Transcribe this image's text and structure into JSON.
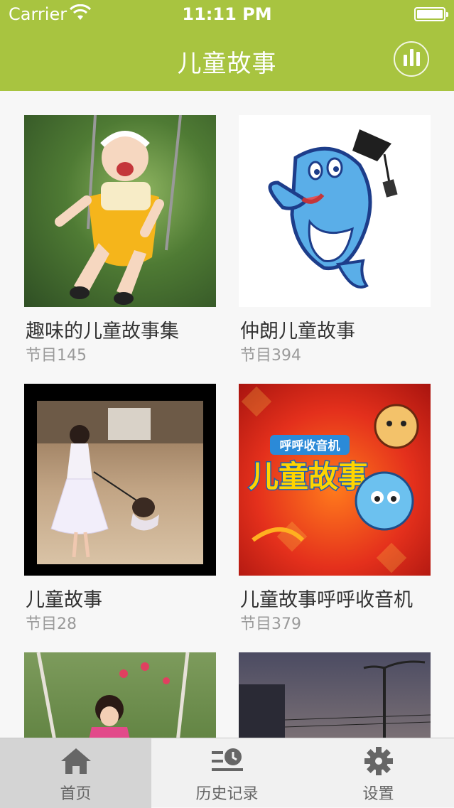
{
  "status_bar": {
    "carrier": "Carrier",
    "time": "11:11 PM"
  },
  "nav": {
    "title": "儿童故事",
    "player_icon": "equalizer-icon"
  },
  "cards": [
    {
      "title": "趣味的儿童故事集",
      "count": "节目145"
    },
    {
      "title": "仲朗儿童故事",
      "count": "节目394"
    },
    {
      "title": "儿童故事",
      "count": "节目28"
    },
    {
      "title": "儿童故事呼呼收音机",
      "count": "节目379"
    },
    {
      "title": "",
      "count": ""
    },
    {
      "title": "",
      "count": ""
    }
  ],
  "thumb_text": {
    "banner_small": "呼呼收音机",
    "banner_big": "儿童故事"
  },
  "tabs": [
    {
      "label": "首页",
      "icon": "home-icon",
      "active": true
    },
    {
      "label": "历史记录",
      "icon": "history-icon",
      "active": false
    },
    {
      "label": "设置",
      "icon": "gear-icon",
      "active": false
    }
  ],
  "colors": {
    "accent": "#a8c440",
    "tab_active": "#d4d4d4"
  }
}
